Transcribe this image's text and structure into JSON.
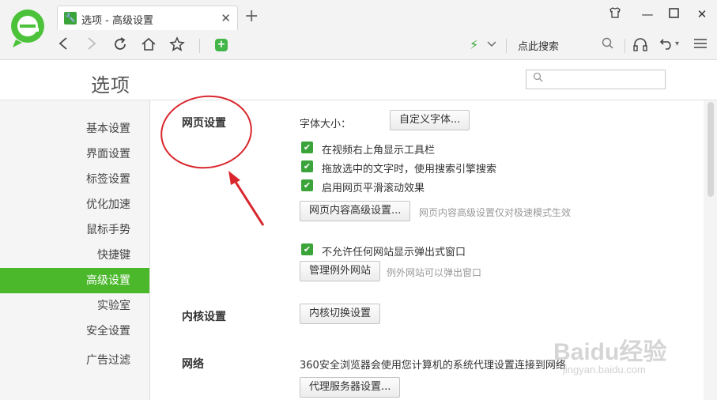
{
  "browser": {
    "tab_title": "选项 - 高级设置",
    "search_label": "点此搜索"
  },
  "options": {
    "title": "选项",
    "search_placeholder": ""
  },
  "sidebar": {
    "items": [
      {
        "label": "基本设置"
      },
      {
        "label": "界面设置"
      },
      {
        "label": "标签设置"
      },
      {
        "label": "优化加速"
      },
      {
        "label": "鼠标手势"
      },
      {
        "label": "快捷键"
      },
      {
        "label": "高级设置"
      },
      {
        "label": "实验室"
      },
      {
        "label": "安全设置"
      },
      {
        "label": "广告过滤"
      }
    ],
    "active_label": "高级设置"
  },
  "sections": {
    "webpage": {
      "title": "网页设置",
      "font_size_label": "字体大小：",
      "custom_font_button": "自定义字体...",
      "checkboxes": [
        {
          "label": "在视频右上角显示工具栏",
          "checked": true
        },
        {
          "label": "拖放选中的文字时，使用搜索引擎搜索",
          "checked": true
        },
        {
          "label": "启用网页平滑滚动效果",
          "checked": true
        }
      ],
      "advanced_button": "网页内容高级设置...",
      "advanced_hint": "网页内容高级设置仅对极速模式生效",
      "popup_checkbox": {
        "label": "不允许任何网站显示弹出式窗口",
        "checked": true
      },
      "manage_button": "管理例外网站",
      "manage_hint": "例外网站可以弹出窗口"
    },
    "kernel": {
      "title": "内核设置",
      "switch_button": "内核切换设置"
    },
    "network": {
      "title": "网络",
      "description": "360安全浏览器会使用您计算机的系统代理设置连接到网络",
      "proxy_button": "代理服务器设置..."
    }
  },
  "watermark": {
    "main": "Baidu经验",
    "sub": "jingyan.baidu.com"
  },
  "colors": {
    "accent": "#4bb82c",
    "annotation": "#d9262c"
  }
}
